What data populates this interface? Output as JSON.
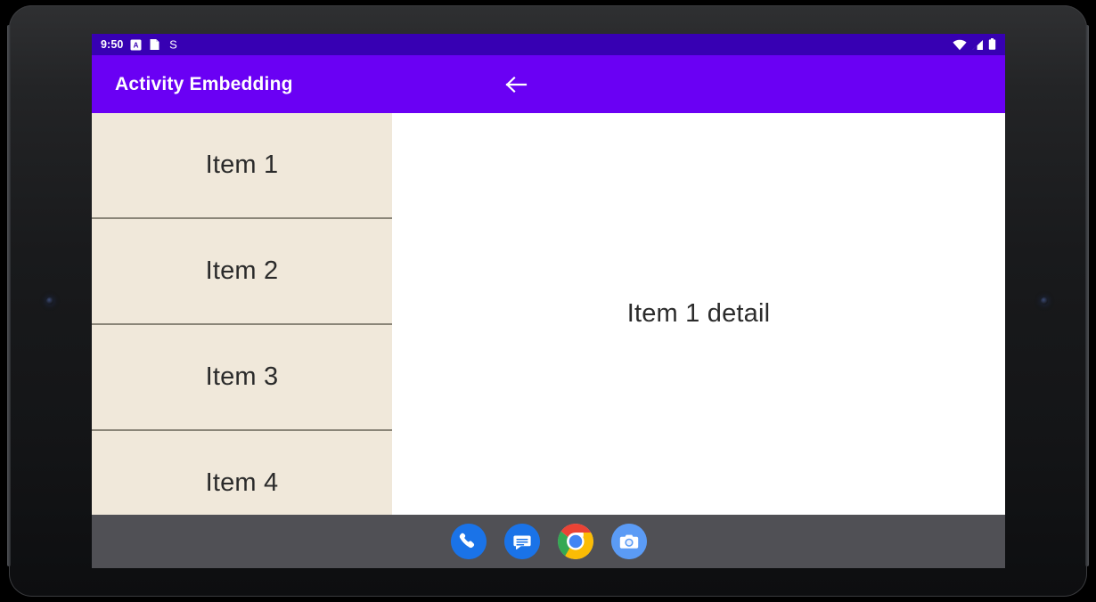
{
  "device": {
    "type": "android-tablet-emulator",
    "frame_color": "#1a1b1d",
    "sensor_count": 2
  },
  "status_bar": {
    "background": "#3700B3",
    "time": "9:50",
    "left_icons": [
      {
        "name": "app-notification-a-icon",
        "glyph": "A"
      },
      {
        "name": "clipboard-notification-icon",
        "glyph": "❑"
      },
      {
        "name": "sync-notification-icon",
        "glyph": "S"
      }
    ],
    "right_icons": [
      {
        "name": "wifi-icon"
      },
      {
        "name": "cellular-signal-icon"
      },
      {
        "name": "battery-icon"
      }
    ]
  },
  "app_bar": {
    "background": "#6A00F4",
    "title": "Activity Embedding",
    "back_button": {
      "name": "back-arrow",
      "glyph": "←"
    }
  },
  "list_pane": {
    "background": "#F0E8DA",
    "divider_color": "#8A8578",
    "items": [
      {
        "label": "Item 1",
        "selected": true
      },
      {
        "label": "Item 2",
        "selected": false
      },
      {
        "label": "Item 3",
        "selected": false
      },
      {
        "label": "Item 4",
        "selected": false
      }
    ]
  },
  "detail_pane": {
    "background": "#FFFFFF",
    "text": "Item 1 detail"
  },
  "nav_bar": {
    "background": "#505055",
    "apps": [
      {
        "name": "phone-app-icon",
        "label": "Phone",
        "color": "#1A73E8"
      },
      {
        "name": "messages-app-icon",
        "label": "Messages",
        "color": "#1A73E8"
      },
      {
        "name": "chrome-app-icon",
        "label": "Chrome",
        "color": "#4285F4"
      },
      {
        "name": "camera-app-icon",
        "label": "Camera",
        "color": "#5B9BF5"
      }
    ]
  }
}
